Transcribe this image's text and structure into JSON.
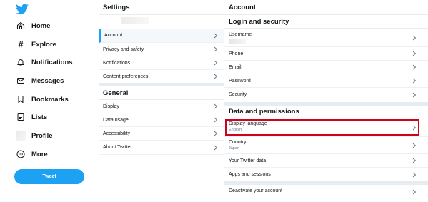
{
  "nav": {
    "logo": "twitter-bird-icon",
    "items": [
      {
        "label": "Home",
        "icon": "home-icon"
      },
      {
        "label": "Explore",
        "icon": "hashtag-icon"
      },
      {
        "label": "Notifications",
        "icon": "bell-icon"
      },
      {
        "label": "Messages",
        "icon": "envelope-icon"
      },
      {
        "label": "Bookmarks",
        "icon": "bookmark-icon"
      },
      {
        "label": "Lists",
        "icon": "list-icon"
      },
      {
        "label": "Profile",
        "icon": "avatar"
      },
      {
        "label": "More",
        "icon": "more-icon"
      }
    ],
    "tweet_button": "Tweet"
  },
  "settings": {
    "title": "Settings",
    "items": [
      {
        "label": "Account",
        "active": true
      },
      {
        "label": "Privacy and safety"
      },
      {
        "label": "Notifications"
      },
      {
        "label": "Content preferences"
      }
    ],
    "general_title": "General",
    "general_items": [
      {
        "label": "Display"
      },
      {
        "label": "Data usage"
      },
      {
        "label": "Accessibility"
      },
      {
        "label": "About Twitter"
      }
    ]
  },
  "account": {
    "title": "Account",
    "login_title": "Login and security",
    "login_items": [
      {
        "label": "Username"
      },
      {
        "label": "Phone"
      },
      {
        "label": "Email"
      },
      {
        "label": "Password"
      },
      {
        "label": "Security"
      }
    ],
    "data_title": "Data and permissions",
    "data_items": [
      {
        "label": "Display language",
        "sub": "English"
      },
      {
        "label": "Country",
        "sub": "Japan"
      },
      {
        "label": "Your Twitter data"
      },
      {
        "label": "Apps and sessions"
      }
    ],
    "deactivate": "Deactivate your account"
  },
  "colors": {
    "accent": "#1da1f2",
    "highlight": "#d0021b",
    "divider": "#e6ecf0"
  }
}
